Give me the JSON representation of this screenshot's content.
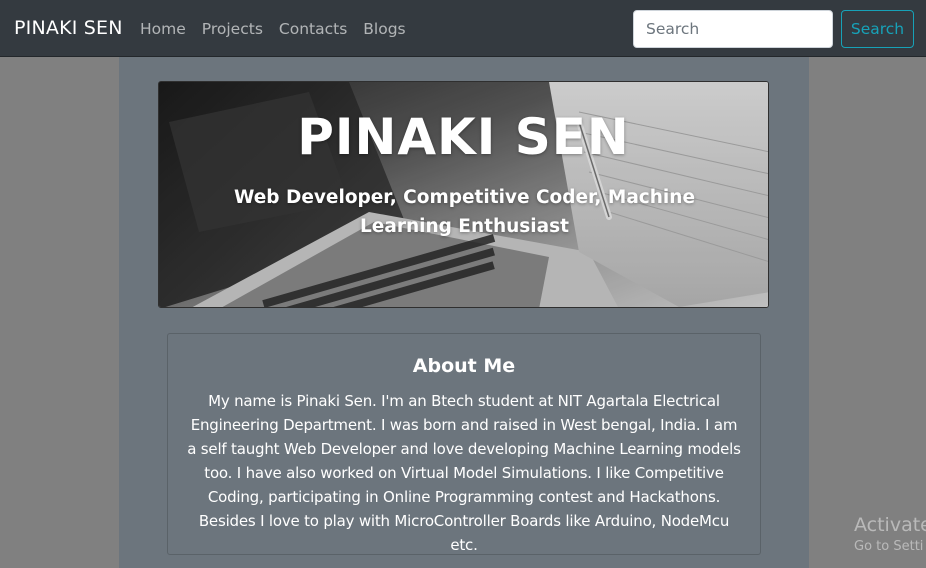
{
  "navbar": {
    "brand": "PINAKI SEN",
    "links": [
      "Home",
      "Projects",
      "Contacts",
      "Blogs"
    ],
    "search_placeholder": "Search",
    "search_button": "Search"
  },
  "hero": {
    "title": "PINAKI SEN",
    "subtitle": "Web Developer, Competitive Coder, Machine Learning Enthusiast"
  },
  "about": {
    "title": "About Me",
    "body": "My name is Pinaki Sen. I'm an Btech student at NIT Agartala Electrical Engineering Department. I was born and raised in West bengal, India. I am a self taught Web Developer and love developing Machine Learning models too. I have also worked on Virtual Model Simulations. I like Competitive Coding, participating in Online Programming contest and Hackathons. Besides I love to play with MicroController Boards like Arduino, NodeMcu etc."
  },
  "watermark": {
    "line1": "Activate",
    "line2": "Go to Setti"
  },
  "colors": {
    "navbar_bg": "#343a40",
    "page_bg": "#808080",
    "content_bg": "#6c757d",
    "accent_info": "#17a2b8"
  }
}
